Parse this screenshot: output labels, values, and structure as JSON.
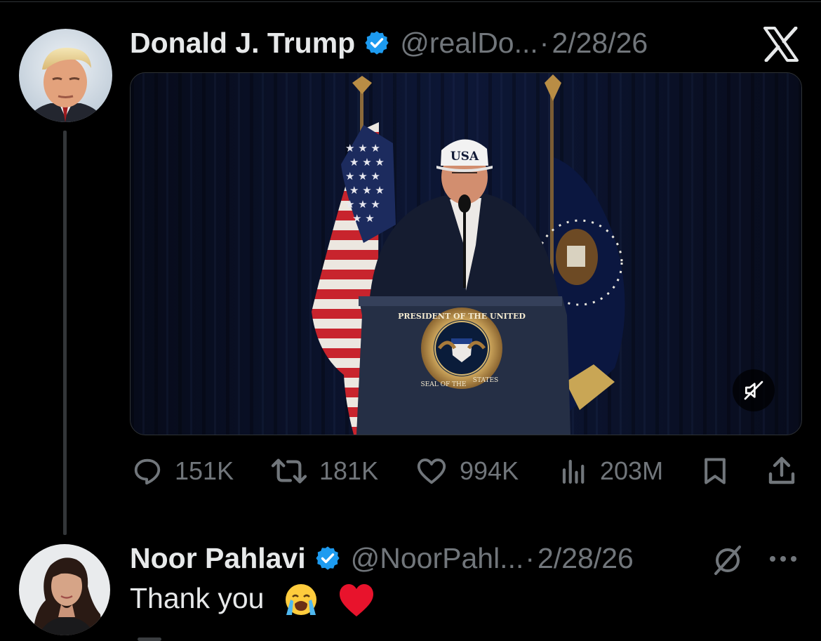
{
  "post": {
    "author_name": "Donald J. Trump",
    "handle": "@realDo...",
    "separator": "·",
    "date": "2/28/26",
    "media": {
      "cap_text": "USA",
      "seal_text_top": "PRESIDENT OF THE UNITED",
      "seal_text_bottom": "SEAL OF THE",
      "seal_text_side": "STATES",
      "muted": true
    },
    "actions": {
      "replies": "151K",
      "reposts": "181K",
      "likes": "994K",
      "views": "203M"
    }
  },
  "reply": {
    "author_name": "Noor Pahlavi",
    "handle": "@NoorPahl...",
    "separator": "·",
    "date": "2/28/26",
    "text": "Thank you",
    "emojis": [
      "loudly-crying-face-emoji",
      "red-heart-emoji"
    ]
  },
  "icons": {
    "verified": "verified-badge-icon",
    "x_logo": "x-logo-icon",
    "mute": "speaker-muted-icon",
    "reply": "reply-icon",
    "repost": "repost-icon",
    "like": "heart-icon",
    "views": "views-chart-icon",
    "bookmark": "bookmark-icon",
    "share": "share-icon",
    "grok": "grok-icon",
    "more": "more-icon"
  },
  "colors": {
    "background": "#000000",
    "text_primary": "#e7e9ea",
    "text_secondary": "#71767b",
    "verified_blue": "#1d9bf0",
    "thread_line": "#333639",
    "border": "#2f3336"
  }
}
